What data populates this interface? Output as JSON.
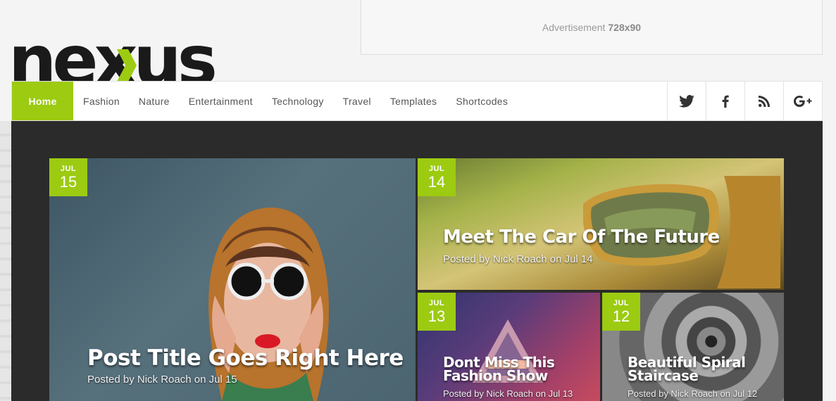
{
  "brand": {
    "logo_text": "nexus",
    "accent": "#9ccb12"
  },
  "ad": {
    "label": "Advertisement",
    "size": "728x90"
  },
  "nav": {
    "items": [
      {
        "label": "Home"
      },
      {
        "label": "Fashion"
      },
      {
        "label": "Nature"
      },
      {
        "label": "Entertainment"
      },
      {
        "label": "Technology"
      },
      {
        "label": "Travel"
      },
      {
        "label": "Templates"
      },
      {
        "label": "Shortcodes"
      }
    ],
    "social": [
      "twitter-icon",
      "facebook-icon",
      "rss-icon",
      "google-plus-icon"
    ]
  },
  "posts": [
    {
      "month": "JUL",
      "day": "15",
      "title": "Post Title Goes Right Here",
      "meta": "Posted by Nick Roach on Jul 15"
    },
    {
      "month": "JUL",
      "day": "14",
      "title": "Meet The Car Of The Future",
      "meta": "Posted by Nick Roach on Jul 14"
    },
    {
      "month": "JUL",
      "day": "13",
      "title": "Dont Miss This Fashion Show",
      "meta": "Posted by Nick Roach on Jul 13"
    },
    {
      "month": "JUL",
      "day": "12",
      "title": "Beautiful Spiral Staircase",
      "meta": "Posted by Nick Roach on Jul 12"
    }
  ]
}
